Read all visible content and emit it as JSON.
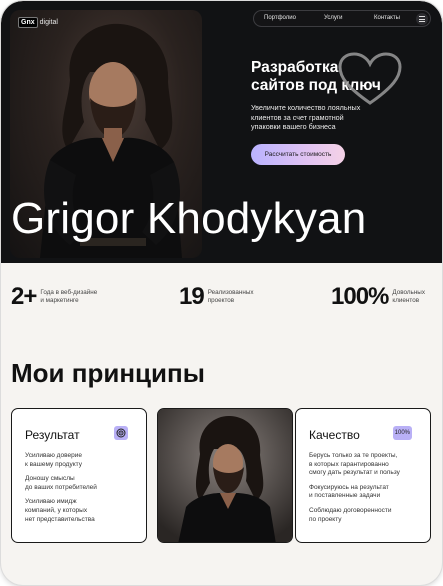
{
  "logo": {
    "mark": "Gnx",
    "text": "digital"
  },
  "nav": {
    "items": [
      "Портфолио",
      "Услуги",
      "Контакты"
    ]
  },
  "hero": {
    "title": "Разработка\nсайтов под ключ",
    "subtitle": "Увеличите количество лояльных\nклиентов за счет грамотной\nупаковки вашего бизнеса",
    "cta_label": "Рассчитать стоимость",
    "overlay_name": "Grigor Khodykyan"
  },
  "stats": [
    {
      "value": "2+",
      "label": "Года в веб-дизайне\nи маркетинге"
    },
    {
      "value": "19",
      "label": "Реализованных\nпроектов"
    },
    {
      "value": "100%",
      "label": "Довольных\nклиентов"
    }
  ],
  "principles": {
    "title": "Мои принципы",
    "cards": [
      {
        "title": "Результат",
        "icon": "target-icon",
        "items": [
          "Усиливаю доверие\nк вашему продукту",
          "Доношу смыслы\nдо ваших потребителей",
          "Усиливаю имидж\nкомпаний, у которых\nнет представительства"
        ]
      },
      {
        "title": "Качество",
        "badge": "100%",
        "items": [
          "Берусь только за те проекты,\nв которых гарантированно\nсмогу дать результат и пользу",
          "Фокусируюсь на результат\nи поставленные задачи",
          "Соблюдаю договоренности\nпо проекту"
        ]
      }
    ]
  },
  "colors": {
    "hero_bg": "#111214",
    "page_bg": "#f6f4f1",
    "accent": "#b9b0f6"
  }
}
